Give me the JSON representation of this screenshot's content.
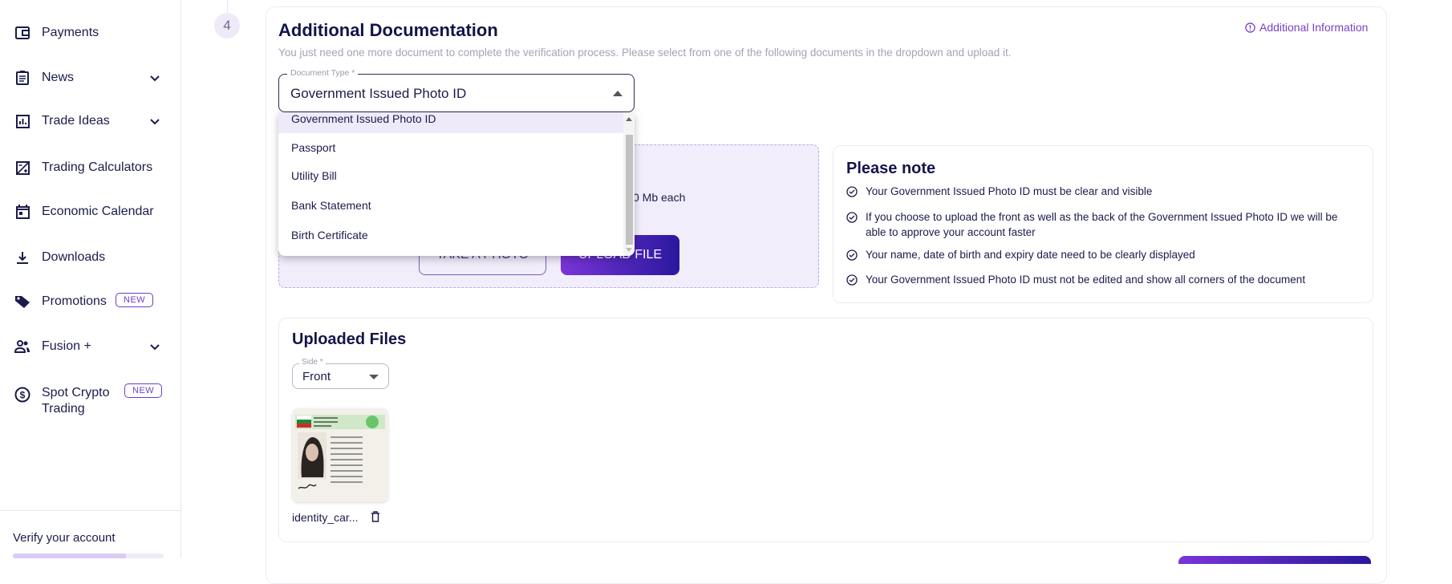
{
  "sidebar": {
    "items": [
      {
        "label": "Payments",
        "icon": "wallet-icon"
      },
      {
        "label": "News",
        "icon": "news-icon",
        "expandable": true
      },
      {
        "label": "Trade Ideas",
        "icon": "bar-chart-icon",
        "expandable": true
      },
      {
        "label": "Trading Calculators",
        "icon": "calculator-icon"
      },
      {
        "label": "Economic Calendar",
        "icon": "calendar-icon"
      },
      {
        "label": "Downloads",
        "icon": "download-icon"
      },
      {
        "label": "Promotions",
        "icon": "tag-icon",
        "badge": "NEW"
      },
      {
        "label": "Fusion +",
        "icon": "users-icon",
        "expandable": true
      },
      {
        "label": "Spot Crypto Trading",
        "icon": "dollar-circle-icon",
        "badge": "NEW"
      }
    ],
    "footer": {
      "verify_label": "Verify your account",
      "progress": 0.75
    }
  },
  "step": {
    "number": "4"
  },
  "section": {
    "title": "Additional Documentation",
    "additional_info": "Additional Information",
    "subtitle": "You just need one more document to complete the verification process. Please select from one of the following documents in the dropdown and upload it.",
    "document_type": {
      "label": "Document Type *",
      "value": "Government Issued Photo ID",
      "options": [
        "Government Issued Photo ID",
        "Passport",
        "Utility Bill",
        "Bank Statement",
        "Birth Certificate"
      ]
    },
    "upload": {
      "size_note_fragment": "0 Mb each",
      "take_photo": "TAKE A PHOTO",
      "upload_file": "UPLOAD FILE"
    },
    "note": {
      "title": "Please note",
      "items": [
        "Your Government Issued Photo ID must be clear and visible",
        "If you choose to upload the front as well as the back of the Government Issued Photo ID we will be able to approve your account faster",
        "Your name, date of birth and expiry date need to be clearly displayed",
        "Your Government Issued Photo ID must not be edited and show all corners of the document"
      ]
    },
    "uploaded": {
      "title": "Uploaded Files",
      "side_label": "Side *",
      "side_value": "Front",
      "file_name": "identity_car..."
    }
  },
  "colors": {
    "navy": "#1b1b4b",
    "accent": "#7b3fc8",
    "button_start": "#7a35d8",
    "button_end": "#2a189e",
    "upload_bg": "#f1edfb"
  }
}
